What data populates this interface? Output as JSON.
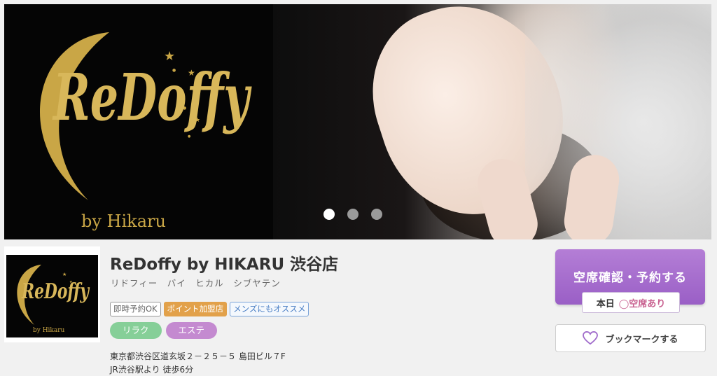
{
  "hero": {
    "logo": {
      "main_text": "ReDoffy",
      "sub_text": "by Hikaru"
    },
    "slides_total": 3,
    "active_slide": 1
  },
  "thumbnail": {
    "main_text": "ReDoffy",
    "sub_text": "by Hikaru"
  },
  "shop": {
    "name": "ReDoffy by HIKARU 渋谷店",
    "kana": "リドフィー　バイ　ヒカル　シブヤテン",
    "tags": [
      "即時予約OK",
      "ポイント加盟店",
      "メンズにもオススメ"
    ],
    "genres": [
      "リラク",
      "エステ"
    ],
    "address": "東京都渋谷区道玄坂２－２５－５ 島田ビル７F",
    "access": "JR渋谷駅より 徒歩6分"
  },
  "actions": {
    "reserve_label": "空席確認・予約する",
    "today_label": "本日",
    "today_status": "◯空席あり",
    "bookmark_label": "ブックマークする"
  },
  "colors": {
    "accent_purple": "#a06ccb",
    "logo_gold": "#c9a646",
    "tag_point": "#e2a14a",
    "genre_relax": "#86cf98",
    "genre_este": "#c48ad0"
  }
}
